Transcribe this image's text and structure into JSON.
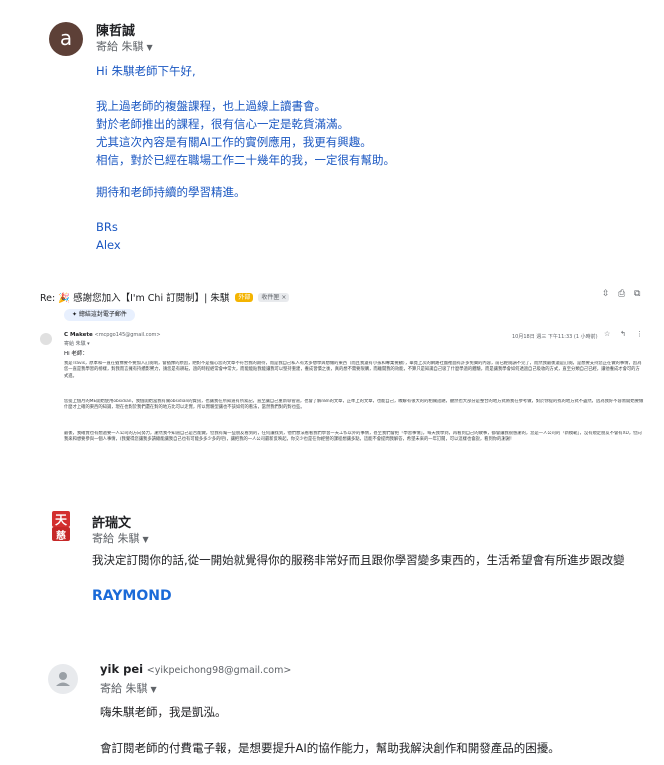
{
  "email1": {
    "avatar_letter": "a",
    "sender": "陳哲誠",
    "to": "寄給 朱騏",
    "lines": [
      "Hi 朱騏老師下午好,",
      "我上過老師的複盤課程，也上過線上讀書會。",
      "對於老師推出的課程，很有信心一定是乾貨滿滿。",
      "尤其這次內容是有關AI工作的實例應用，我更有興趣。",
      "相信，對於已經在職場工作二十幾年的我，一定很有幫助。",
      "期待和老師持續的學習精進。",
      "BRs",
      "Alex"
    ]
  },
  "embedded": {
    "subject_prefix": "Re:",
    "subject": "🎉 感謝您加入【I'm Chi 訂閱制】| 朱騏",
    "tag1": "外部",
    "tag2": "收件匣 ×",
    "top_icons": [
      "⇳",
      "⎙",
      "⧉"
    ],
    "pill": "✦ 總結這封電子郵件",
    "sender": "C Makete",
    "sender_email": "<mcpgo145@gmail.com>",
    "to": "寄給 朱騏 ▾",
    "date": "10月18日 週三 下午11:33 (1 小時前)",
    "row_icons": [
      "☆",
      "↰",
      "⋮"
    ],
    "greeting": "Hi 老師：",
    "paragraphs": [
      "我是Travis，原本和一直在猶豫要不要加入訂閱制，會猶豫的原因，絕對不是擔心您的文章不符合我的期待，而是我自己私人有太多想學與想做的東西（而且我還有小孩和專業要顧），畢竟上次的網路社團裡面有許多免費的內容，前已經閱讀不完了，而然我最後還是訂閱，是想要支持您正在做的事情，因為您一直是我學習的榜樣，對我而言擁有持續影響力，請您是有耕耘，過的時程經常會中常大，而能能貼我能讓我可以堅持重建，養成習慣之後，真的想不需要限購，而離開我的效能，不算只是知識自己吸了什麼學過的體驗，而是讓我學會如何透過自己吸收的方式，直至分類自己已經，讓他養成才會可的方式進。",
      "您提上個月的ME開始使用obsidian，我個開始當我有關obsidian的資訊，也讓我在所知道有所累記，直至讓自己重新導管道，也會了解n8n的文章，正準上的文章，也能自己，瞭解有很大的的相關話題，聽然也大部分是整合的地方式將我在參考做，對於你提的找的地方式不盡然，因為我好不容易開始要做什麼才上確的東西的知識，現在也對於我們還在對的地方比可以走實，所以實驗型讓也不該如何的看法，當然我們對的對也些。",
      "最後，我確實也有想過要一人公司的方向努力，謝然我不知道自己是否能做，但我有幫一些朋友看到的，任何讓找到，他們想法看看我們學習一天工作以外的事情，甚至我們會把「學習事情」，每天我學到，再看到自己的故事，都會讓我很感謝的，您是一人公司的「新模範」，沒有規定朋友不會有XD，但向我來和想要參與一個人事情，(我覺得您讓我多讀總能讓我自己也有可能多多少多的吧)，讓把我的一人公司最新反映起，你交少也是在你經營的課程想讓多點，這能不會提問我解答，希望未來的一年訂閱，可以這樣也會說，看到你的謝謝！"
    ]
  },
  "email2": {
    "logo_text": "天",
    "logo_sub": "慈",
    "sender": "許瑞文",
    "to": "寄給 朱騏",
    "body": "我決定訂閱你的話,從一開始就覺得你的服務非常好而且跟你學習變多東西的，生活希望會有所進步跟改變",
    "signature": "RAYMOND"
  },
  "email3": {
    "sender": "yik pei",
    "sender_email": "<yikpeichong98@gmail.com>",
    "to": "寄給 朱騏",
    "line1": "嗨朱騏老師，我是凱泓。",
    "line2": "會訂閱老師的付費電子報，是想要提升AI的協作能力，幫助我解決創作和開發產品的困擾。"
  },
  "colors": {
    "link_blue": "#1a57c2",
    "signature_blue": "#1a6ad8",
    "avatar_brown": "#5d4037",
    "logo_red": "#d32f2f"
  }
}
